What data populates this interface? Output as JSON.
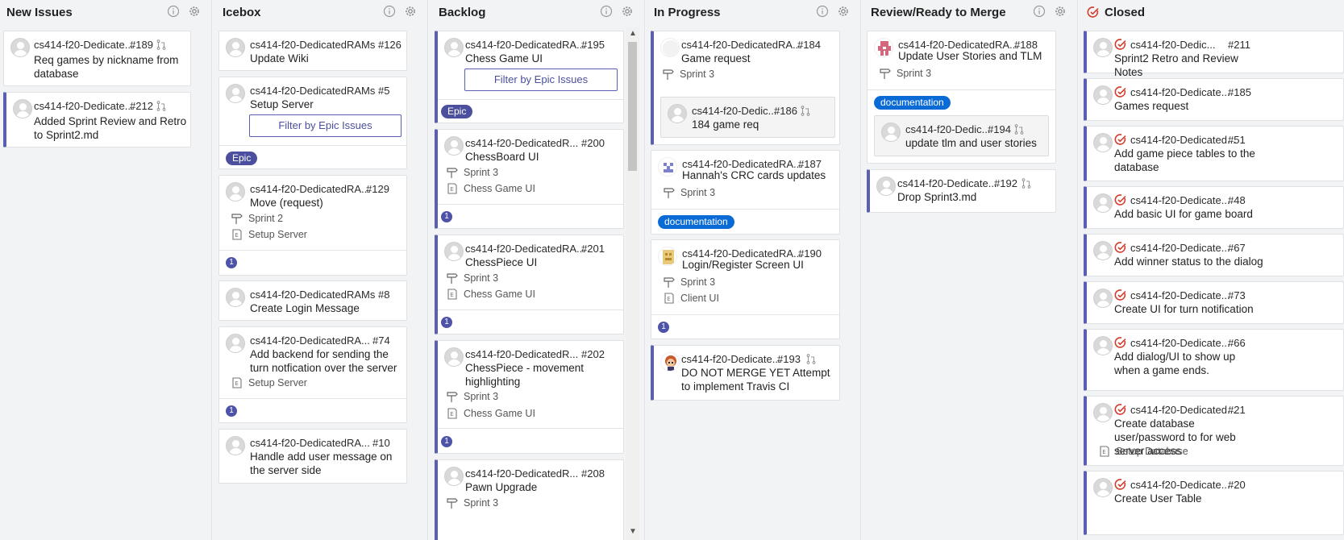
{
  "columns": [
    {
      "title": "New Issues"
    },
    {
      "title": "Icebox"
    },
    {
      "title": "Backlog"
    },
    {
      "title": "In Progress"
    },
    {
      "title": "Review/Ready to Merge"
    },
    {
      "title": "Closed"
    }
  ],
  "new_issues": [
    {
      "repo": "cs414-f20-Dedicate...",
      "num": "#189",
      "title": "Req games by nickname from database"
    },
    {
      "repo": "cs414-f20-Dedicate...",
      "num": "#212",
      "title": "Added Sprint Review and Retro to Sprint2.md"
    }
  ],
  "icebox": [
    {
      "repo": "cs414-f20-DedicatedRAMs #126",
      "title": "Update Wiki"
    },
    {
      "repo": "cs414-f20-DedicatedRAMs #5",
      "title": "Setup Server",
      "button": "Filter by Epic Issues",
      "badge": "Epic"
    },
    {
      "repo": "cs414-f20-DedicatedRA...",
      "num": "#129",
      "title": "Move (request)",
      "milestone": "Sprint 2",
      "epic": "Setup Server",
      "count": "1"
    },
    {
      "repo": "cs414-f20-DedicatedRAMs #8",
      "title": "Create Login Message"
    },
    {
      "repo": "cs414-f20-DedicatedRA...",
      "num": "#74",
      "title": "Add backend for sending the turn notfication over the server",
      "epic": "Setup Server",
      "count": "1"
    },
    {
      "repo": "cs414-f20-DedicatedRA...",
      "num": "#10",
      "title": "Handle add user message on the server side"
    }
  ],
  "backlog": [
    {
      "repo": "cs414-f20-DedicatedRA...",
      "num": "#195",
      "title": "Chess Game UI",
      "button": "Filter by Epic Issues",
      "badge": "Epic"
    },
    {
      "repo": "cs414-f20-DedicatedR...",
      "num": "#200",
      "title": "ChessBoard UI",
      "milestone": "Sprint 3",
      "epic": "Chess Game UI",
      "count": "1"
    },
    {
      "repo": "cs414-f20-DedicatedRA...",
      "num": "#201",
      "title": "ChessPiece UI",
      "milestone": "Sprint 3",
      "epic": "Chess Game UI",
      "count": "1"
    },
    {
      "repo": "cs414-f20-DedicatedR...",
      "num": "#202",
      "title": "ChessPiece - movement highlighting",
      "milestone": "Sprint 3",
      "epic": "Chess Game UI",
      "count": "1"
    },
    {
      "repo": "cs414-f20-DedicatedR...",
      "num": "#208",
      "title": "Pawn Upgrade",
      "milestone": "Sprint 3"
    }
  ],
  "in_progress": [
    {
      "repo": "cs414-f20-DedicatedRA...",
      "num": "#184",
      "title": "Game request",
      "milestone": "Sprint 3",
      "sub": {
        "repo": "cs414-f20-Dedic...",
        "num": "#186",
        "title": "184 game req"
      }
    },
    {
      "repo": "cs414-f20-DedicatedRA...",
      "num": "#187",
      "title": "Hannah's CRC cards updates",
      "milestone": "Sprint 3",
      "badge": "documentation"
    },
    {
      "repo": "cs414-f20-DedicatedRA...",
      "num": "#190",
      "title": "Login/Register Screen UI",
      "milestone": "Sprint 3",
      "epic": "Client UI",
      "count": "1"
    },
    {
      "repo": "cs414-f20-Dedicate...",
      "num": "#193",
      "title": "DO NOT MERGE YET Attempt to implement Travis CI"
    }
  ],
  "review": [
    {
      "repo": "cs414-f20-DedicatedRA...",
      "num": "#188",
      "title": "Update User Stories and TLM",
      "milestone": "Sprint 3",
      "badge": "documentation",
      "sub": {
        "repo": "cs414-f20-Dedic...",
        "num": "#194",
        "title": "update tlm and user stories"
      }
    },
    {
      "repo": "cs414-f20-Dedicate...",
      "num": "#192",
      "title": "Drop Sprint3.md"
    }
  ],
  "closed": [
    {
      "repo": "cs414-f20-Dedic...",
      "num": "#211",
      "title": "Sprint2 Retro and Review Notes"
    },
    {
      "repo": "cs414-f20-Dedicate...",
      "num": "#185",
      "title": "Games request"
    },
    {
      "repo": "cs414-f20-Dedicated...",
      "num": "#51",
      "title": "Add game piece tables to the database"
    },
    {
      "repo": "cs414-f20-Dedicate...",
      "num": "#48",
      "title": "Add basic UI for game board"
    },
    {
      "repo": "cs414-f20-Dedicate...",
      "num": "#67",
      "title": "Add winner status to the dialog"
    },
    {
      "repo": "cs414-f20-Dedicate...",
      "num": "#73",
      "title": "Create UI for turn notification"
    },
    {
      "repo": "cs414-f20-Dedicate...",
      "num": "#66",
      "title": "Add dialog/UI to show up when a game ends."
    },
    {
      "repo": "cs414-f20-Dedicated...",
      "num": "#21",
      "title": "Create database user/password to for web server access",
      "epic": "Setup Database"
    },
    {
      "repo": "cs414-f20-Dedicate...",
      "num": "#20",
      "title": "Create User Table"
    }
  ],
  "colors": {
    "epic_border": "#5b5fb3",
    "badge_epic": "#4b4f9e",
    "badge_doc": "#0b6bd6",
    "closed_red": "#d43b2a"
  },
  "icons": [
    "info-icon",
    "gear-icon",
    "pull-request-icon",
    "milestone-icon",
    "epic-icon",
    "closed-issue-icon"
  ]
}
